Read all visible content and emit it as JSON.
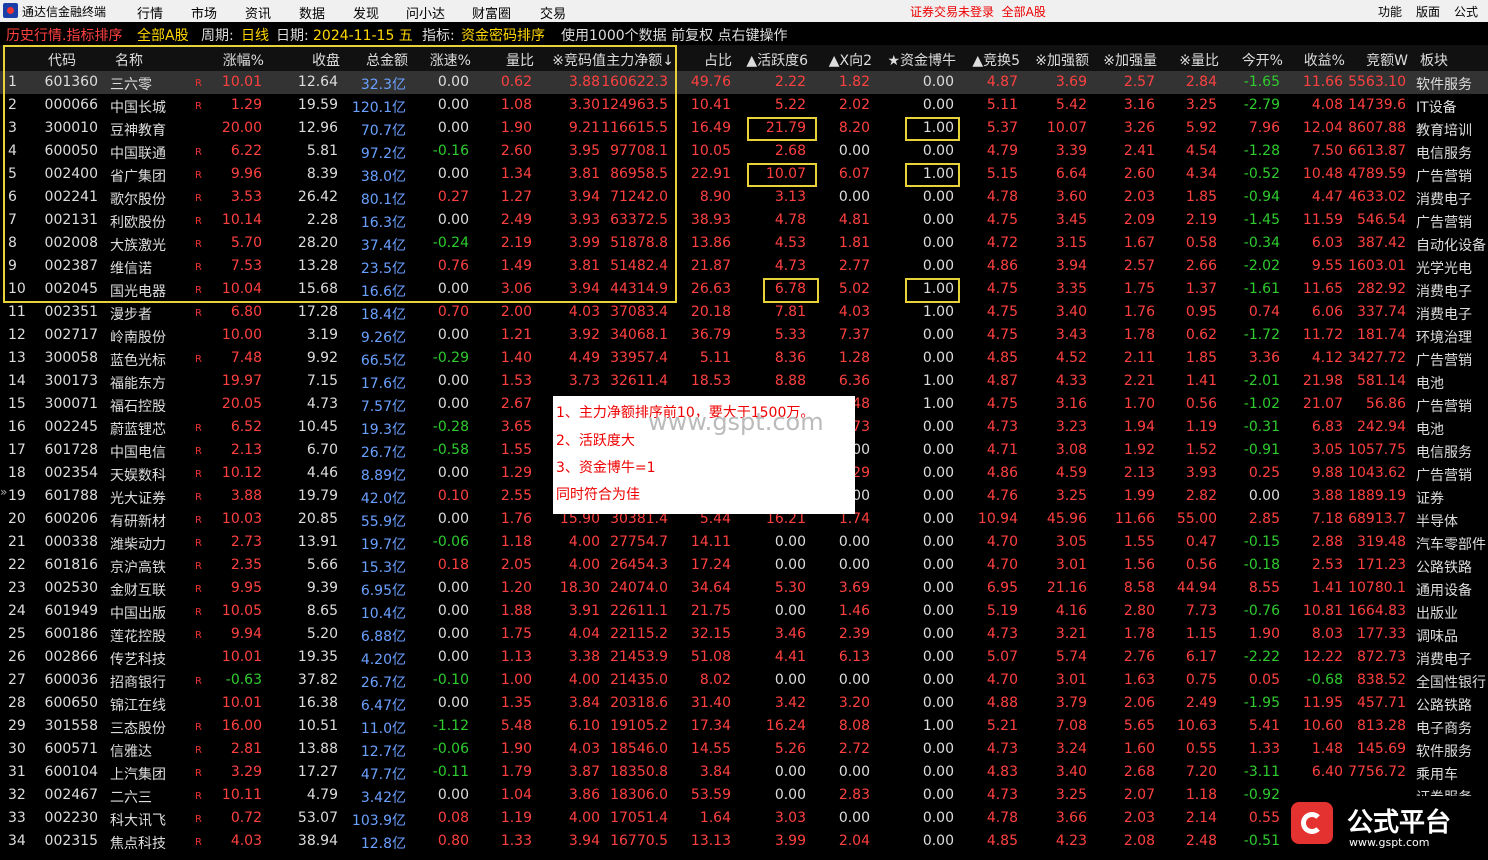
{
  "menubar": {
    "app_title": "通达信金融终端",
    "items": [
      "行情",
      "市场",
      "资讯",
      "数据",
      "发现",
      "问小达",
      "财富圈",
      "交易"
    ],
    "login_status": "证券交易未登录",
    "market": "全部A股",
    "right_items": [
      "功能",
      "版面",
      "公式"
    ]
  },
  "infobar": {
    "title": "历史行情.指标排序",
    "market": "全部A股",
    "period_label": "周期:",
    "period": "日线",
    "date_label": "日期:",
    "date": "2024-11-15 五",
    "indicator_label": "指标:",
    "indicator": "资金密码排序",
    "note": "使用1000个数据 前复权 点右键操作"
  },
  "headers": [
    "代码",
    "名称",
    "涨幅%",
    "收盘",
    "总金额",
    "涨速%",
    "量比",
    "※竞码值",
    "主力净额↓",
    "占比",
    "▲活跃度6",
    "▲X向2",
    "★资金博牛",
    "▲竞换5",
    "※加强额",
    "※加强量",
    "※量比",
    "今开%",
    "收益%",
    "竞额W",
    "板块"
  ],
  "colors": {
    "up": "#ff4040",
    "down": "#2ecc2e",
    "flat": "#dddddd",
    "amount": "#6aa0ff",
    "highlight_box": "#e8d23a"
  },
  "rows": [
    [
      "1",
      "601360",
      "三六零",
      "R",
      "10.01",
      "12.64",
      "32.3亿",
      "0.00",
      "0.62",
      "3.88",
      "160622.3",
      "49.76",
      "2.22",
      "1.82",
      "0.00",
      "4.87",
      "3.69",
      "2.57",
      "2.84",
      "-1.65",
      "11.66",
      "5563.10",
      "软件服务"
    ],
    [
      "2",
      "000066",
      "中国长城",
      "R",
      "1.29",
      "19.59",
      "120.1亿",
      "0.00",
      "1.08",
      "3.30",
      "124963.5",
      "10.41",
      "5.22",
      "2.02",
      "0.00",
      "5.11",
      "5.42",
      "3.16",
      "3.25",
      "-2.79",
      "4.08",
      "14739.6",
      "IT设备"
    ],
    [
      "3",
      "300010",
      "豆神教育",
      "",
      "20.00",
      "12.96",
      "70.7亿",
      "0.00",
      "1.90",
      "9.21",
      "116615.5",
      "16.49",
      "21.79",
      "8.20",
      "1.00",
      "5.37",
      "10.07",
      "3.26",
      "5.92",
      "7.96",
      "12.04",
      "8607.88",
      "教育培训"
    ],
    [
      "4",
      "600050",
      "中国联通",
      "R",
      "6.22",
      "5.81",
      "97.2亿",
      "-0.16",
      "2.60",
      "3.95",
      "97708.1",
      "10.05",
      "2.68",
      "0.00",
      "0.00",
      "4.79",
      "3.39",
      "2.41",
      "4.54",
      "-1.28",
      "7.50",
      "6613.87",
      "电信服务"
    ],
    [
      "5",
      "002400",
      "省广集团",
      "R",
      "9.96",
      "8.39",
      "38.0亿",
      "0.00",
      "1.34",
      "3.81",
      "86958.5",
      "22.91",
      "10.07",
      "6.07",
      "1.00",
      "5.15",
      "6.64",
      "2.60",
      "4.34",
      "-0.52",
      "10.48",
      "4789.59",
      "广告营销"
    ],
    [
      "6",
      "002241",
      "歌尔股份",
      "R",
      "3.53",
      "26.42",
      "80.1亿",
      "0.27",
      "1.27",
      "3.94",
      "71242.0",
      "8.90",
      "3.13",
      "0.00",
      "0.00",
      "4.78",
      "3.60",
      "2.03",
      "1.85",
      "-0.94",
      "4.47",
      "4633.02",
      "消费电子"
    ],
    [
      "7",
      "002131",
      "利欧股份",
      "R",
      "10.14",
      "2.28",
      "16.3亿",
      "0.00",
      "2.49",
      "3.93",
      "63372.5",
      "38.93",
      "4.78",
      "4.81",
      "0.00",
      "4.75",
      "3.45",
      "2.09",
      "2.19",
      "-1.45",
      "11.59",
      "546.54",
      "广告营销"
    ],
    [
      "8",
      "002008",
      "大族激光",
      "R",
      "5.70",
      "28.20",
      "37.4亿",
      "-0.24",
      "2.19",
      "3.99",
      "51878.8",
      "13.86",
      "4.53",
      "1.81",
      "0.00",
      "4.72",
      "3.15",
      "1.67",
      "0.58",
      "-0.34",
      "6.03",
      "387.42",
      "自动化设备"
    ],
    [
      "9",
      "002387",
      "维信诺",
      "R",
      "7.53",
      "13.28",
      "23.5亿",
      "0.76",
      "1.49",
      "3.81",
      "51482.4",
      "21.87",
      "4.73",
      "2.77",
      "0.00",
      "4.86",
      "3.94",
      "2.57",
      "2.66",
      "-2.02",
      "9.55",
      "1603.01",
      "光学光电"
    ],
    [
      "10",
      "002045",
      "国光电器",
      "R",
      "10.04",
      "15.68",
      "16.6亿",
      "0.00",
      "3.06",
      "3.94",
      "44314.9",
      "26.63",
      "6.78",
      "5.02",
      "1.00",
      "4.75",
      "3.35",
      "1.75",
      "1.37",
      "-1.61",
      "11.65",
      "282.92",
      "消费电子"
    ],
    [
      "11",
      "002351",
      "漫步者",
      "R",
      "6.80",
      "17.28",
      "18.4亿",
      "0.70",
      "2.00",
      "4.03",
      "37083.4",
      "20.18",
      "7.81",
      "4.03",
      "1.00",
      "4.75",
      "3.40",
      "1.76",
      "0.95",
      "0.74",
      "6.06",
      "337.74",
      "消费电子"
    ],
    [
      "12",
      "002717",
      "岭南股份",
      "",
      "10.00",
      "3.19",
      "9.26亿",
      "0.00",
      "1.21",
      "3.92",
      "34068.1",
      "36.79",
      "5.33",
      "7.37",
      "0.00",
      "4.75",
      "3.43",
      "1.78",
      "0.62",
      "-1.72",
      "11.72",
      "181.74",
      "环境治理"
    ],
    [
      "13",
      "300058",
      "蓝色光标",
      "R",
      "7.48",
      "9.92",
      "66.5亿",
      "-0.29",
      "1.40",
      "4.49",
      "33957.4",
      "5.11",
      "8.36",
      "1.28",
      "0.00",
      "4.85",
      "4.52",
      "2.11",
      "1.85",
      "3.36",
      "4.12",
      "3427.72",
      "广告营销"
    ],
    [
      "14",
      "300173",
      "福能东方",
      "",
      "19.97",
      "7.15",
      "17.6亿",
      "0.00",
      "1.53",
      "3.73",
      "32611.4",
      "18.53",
      "8.88",
      "6.36",
      "1.00",
      "4.87",
      "4.33",
      "2.21",
      "1.41",
      "-2.01",
      "21.98",
      "581.14",
      "电池"
    ],
    [
      "15",
      "300071",
      "福石控股",
      "",
      "20.05",
      "4.73",
      "7.57亿",
      "0.00",
      "2.67",
      "",
      "",
      "",
      "",
      "48",
      "1.00",
      "4.75",
      "3.16",
      "1.70",
      "0.56",
      "-1.02",
      "21.07",
      "56.86",
      "广告营销"
    ],
    [
      "16",
      "002245",
      "蔚蓝锂芯",
      "R",
      "6.52",
      "10.45",
      "19.3亿",
      "-0.28",
      "3.65",
      "",
      "",
      "",
      "",
      "73",
      "0.00",
      "4.73",
      "3.23",
      "1.94",
      "1.19",
      "-0.31",
      "6.83",
      "242.94",
      "电池"
    ],
    [
      "17",
      "601728",
      "中国电信",
      "R",
      "2.13",
      "6.70",
      "26.7亿",
      "-0.58",
      "1.55",
      "",
      "",
      "",
      "",
      "00",
      "0.00",
      "4.71",
      "3.08",
      "1.92",
      "1.52",
      "-0.91",
      "3.05",
      "1057.75",
      "电信服务"
    ],
    [
      "18",
      "002354",
      "天娱数科",
      "R",
      "10.12",
      "4.46",
      "8.89亿",
      "0.00",
      "1.29",
      "",
      "",
      "",
      "",
      "29",
      "0.00",
      "4.86",
      "4.59",
      "2.13",
      "3.93",
      "0.25",
      "9.88",
      "1043.62",
      "广告营销"
    ],
    [
      "19",
      "601788",
      "光大证券",
      "R",
      "3.88",
      "19.79",
      "42.0亿",
      "0.10",
      "2.55",
      "",
      "",
      "",
      "",
      "00",
      "0.00",
      "4.76",
      "3.25",
      "1.99",
      "2.82",
      "0.00",
      "3.88",
      "1889.19",
      "证券"
    ],
    [
      "20",
      "600206",
      "有研新材",
      "R",
      "10.03",
      "20.85",
      "55.9亿",
      "0.00",
      "1.76",
      "15.90",
      "30381.4",
      "5.44",
      "16.21",
      "1.74",
      "0.00",
      "10.94",
      "45.96",
      "11.66",
      "55.00",
      "2.85",
      "7.18",
      "68913.7",
      "半导体"
    ],
    [
      "21",
      "000338",
      "潍柴动力",
      "R",
      "2.73",
      "13.91",
      "19.7亿",
      "-0.06",
      "1.18",
      "4.00",
      "27754.7",
      "14.11",
      "0.00",
      "0.00",
      "0.00",
      "4.70",
      "3.05",
      "1.55",
      "0.47",
      "-0.15",
      "2.88",
      "319.48",
      "汽车零部件"
    ],
    [
      "22",
      "601816",
      "京沪高铁",
      "R",
      "2.35",
      "5.66",
      "15.3亿",
      "0.18",
      "2.05",
      "4.00",
      "26454.3",
      "17.24",
      "0.00",
      "0.00",
      "0.00",
      "4.70",
      "3.01",
      "1.56",
      "0.56",
      "-0.18",
      "2.53",
      "171.23",
      "公路铁路"
    ],
    [
      "23",
      "002530",
      "金财互联",
      "R",
      "9.95",
      "9.39",
      "6.95亿",
      "0.00",
      "1.20",
      "18.30",
      "24074.0",
      "34.64",
      "5.30",
      "3.69",
      "0.00",
      "6.95",
      "21.16",
      "8.58",
      "44.94",
      "8.55",
      "1.41",
      "10780.1",
      "通用设备"
    ],
    [
      "24",
      "601949",
      "中国出版",
      "R",
      "10.05",
      "8.65",
      "10.4亿",
      "0.00",
      "1.88",
      "3.91",
      "22611.1",
      "21.75",
      "0.00",
      "1.46",
      "0.00",
      "5.19",
      "4.16",
      "2.80",
      "7.73",
      "-0.76",
      "10.81",
      "1664.83",
      "出版业"
    ],
    [
      "25",
      "600186",
      "莲花控股",
      "R",
      "9.94",
      "5.20",
      "6.88亿",
      "0.00",
      "1.75",
      "4.04",
      "22115.2",
      "32.15",
      "3.46",
      "2.39",
      "0.00",
      "4.73",
      "3.21",
      "1.78",
      "1.15",
      "1.90",
      "8.03",
      "177.33",
      "调味品"
    ],
    [
      "26",
      "002866",
      "传艺科技",
      "",
      "10.01",
      "19.35",
      "4.20亿",
      "0.00",
      "1.13",
      "3.38",
      "21453.9",
      "51.08",
      "4.41",
      "6.13",
      "0.00",
      "5.07",
      "5.74",
      "2.76",
      "6.17",
      "-2.22",
      "12.22",
      "872.73",
      "消费电子"
    ],
    [
      "27",
      "600036",
      "招商银行",
      "R",
      "-0.63",
      "37.82",
      "26.7亿",
      "-0.10",
      "1.00",
      "4.00",
      "21435.0",
      "8.02",
      "0.00",
      "0.00",
      "0.00",
      "4.70",
      "3.01",
      "1.63",
      "0.75",
      "0.05",
      "-0.68",
      "838.52",
      "全国性银行"
    ],
    [
      "28",
      "600650",
      "锦江在线",
      "",
      "10.01",
      "16.38",
      "6.47亿",
      "0.00",
      "1.35",
      "3.84",
      "20318.6",
      "31.40",
      "3.42",
      "3.20",
      "0.00",
      "4.88",
      "3.79",
      "2.06",
      "2.49",
      "-1.95",
      "11.95",
      "457.71",
      "公路铁路"
    ],
    [
      "29",
      "301558",
      "三态股份",
      "R",
      "16.00",
      "10.51",
      "11.0亿",
      "-1.12",
      "5.48",
      "6.10",
      "19105.2",
      "17.34",
      "16.24",
      "8.08",
      "1.00",
      "5.21",
      "7.08",
      "5.65",
      "10.63",
      "5.41",
      "10.60",
      "813.28",
      "电子商务"
    ],
    [
      "30",
      "600571",
      "信雅达",
      "R",
      "2.81",
      "13.88",
      "12.7亿",
      "-0.06",
      "1.90",
      "4.03",
      "18546.0",
      "14.55",
      "5.26",
      "2.72",
      "0.00",
      "4.73",
      "3.24",
      "1.60",
      "0.55",
      "1.33",
      "1.48",
      "145.69",
      "软件服务"
    ],
    [
      "31",
      "600104",
      "上汽集团",
      "R",
      "3.29",
      "17.27",
      "47.7亿",
      "-0.11",
      "1.79",
      "3.87",
      "18350.8",
      "3.84",
      "0.00",
      "0.00",
      "0.00",
      "4.83",
      "3.40",
      "2.68",
      "7.20",
      "-3.11",
      "6.40",
      "7756.72",
      "乘用车"
    ],
    [
      "32",
      "002467",
      "二六三",
      "R",
      "10.11",
      "4.79",
      "3.42亿",
      "0.00",
      "1.04",
      "3.86",
      "18306.0",
      "53.59",
      "0.00",
      "2.83",
      "0.00",
      "4.73",
      "3.25",
      "2.07",
      "1.18",
      "-0.92",
      "",
      "",
      "证券服务"
    ],
    [
      "33",
      "002230",
      "科大讯飞",
      "R",
      "0.72",
      "53.07",
      "103.9亿",
      "0.08",
      "1.19",
      "4.00",
      "17051.4",
      "1.64",
      "3.03",
      "0.00",
      "0.00",
      "4.78",
      "3.66",
      "2.03",
      "2.14",
      "0.55",
      "",
      "",
      ""
    ],
    [
      "34",
      "002315",
      "焦点科技",
      "R",
      "4.03",
      "38.94",
      "12.8亿",
      "0.80",
      "1.33",
      "3.94",
      "16770.5",
      "13.13",
      "3.99",
      "2.04",
      "0.00",
      "4.85",
      "4.23",
      "2.08",
      "2.48",
      "-0.51",
      "",
      "",
      ""
    ]
  ],
  "note": {
    "line1": "1、主力净额排序前10，要大于1500万。",
    "line2": "2、活跃度大",
    "line3": "3、资金博牛=1",
    "line4": "同时符合为佳",
    "watermark": "www.gspt.com"
  },
  "brand": {
    "name": "公式平台",
    "url": "www.gspt.com"
  },
  "side_arrow": "»"
}
